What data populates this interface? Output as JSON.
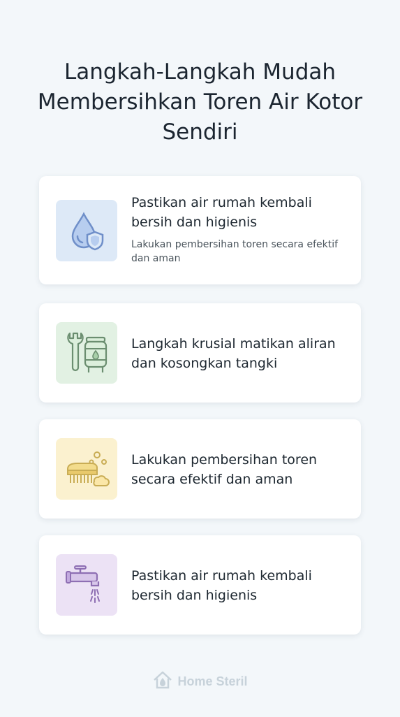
{
  "title": "Langkah-Langkah Mudah Membersihkan Toren Air Kotor Sendiri",
  "cards": [
    {
      "heading": "Pastikan air rumah kembali bersih dan higienis",
      "sub": "Lakukan pembersihan toren secara efektif dan aman",
      "icon": "water-drop-shield-icon",
      "bg": "#dde9f7"
    },
    {
      "heading": "Langkah krusial matikan aliran dan kosongkan tangki",
      "icon": "wrench-tank-icon",
      "bg": "#e2f1e3"
    },
    {
      "heading": "Lakukan pembersihan toren secara efektif dan aman",
      "icon": "scrub-brush-icon",
      "bg": "#fbf1cf"
    },
    {
      "heading": "Pastikan air rumah kembali bersih dan higienis",
      "icon": "faucet-icon",
      "bg": "#ece2f5"
    }
  ],
  "footer": {
    "brand": "Home Steril",
    "icon": "house-drop-logo-icon"
  }
}
